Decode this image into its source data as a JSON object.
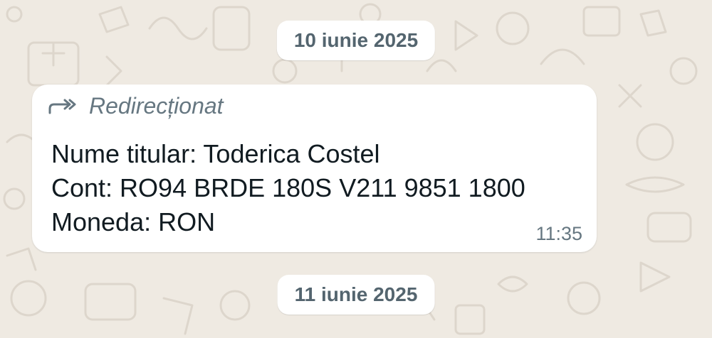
{
  "chat": {
    "dates": [
      "10 iunie 2025",
      "11 iunie 2025"
    ],
    "message": {
      "forwarded_label": "Redirecționat",
      "lines": [
        "Nume titular: Toderica Costel",
        "Cont: RO94 BRDE 180S V211 9851 1800",
        "Moneda: RON"
      ],
      "time": "11:35",
      "forwarded_icon": "forward-arrow-icon"
    }
  },
  "colors": {
    "background": "#efeae2",
    "bubble": "#ffffff",
    "text_primary": "#111b21",
    "text_secondary": "#667781",
    "date_text": "#54656f"
  }
}
